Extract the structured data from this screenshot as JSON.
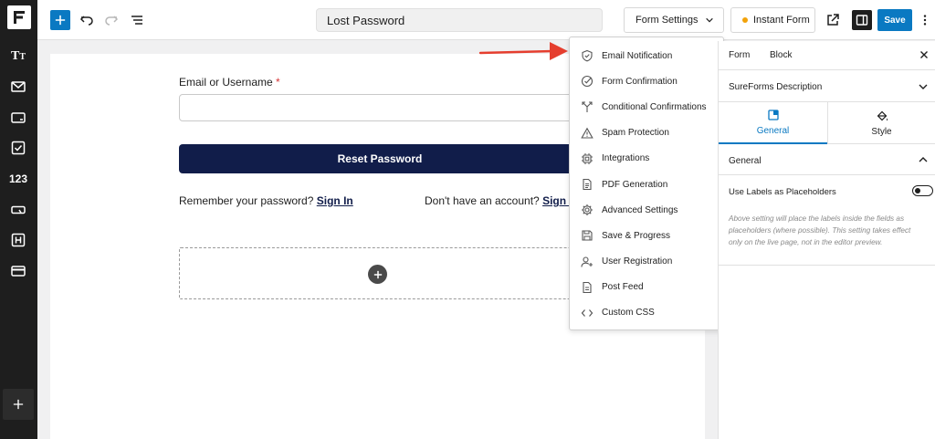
{
  "sidebar": {
    "logo": "sureforms-logo",
    "numbers_label": "123",
    "icons": [
      "typography-icon",
      "mail-icon",
      "input-icon",
      "checkbox-icon",
      "numbers-icon",
      "button-icon",
      "heading-icon",
      "card-icon"
    ],
    "add_icon": "plus-icon"
  },
  "toolbar": {
    "title": "Lost Password",
    "form_settings_label": "Form Settings",
    "instant_form_label": "Instant Form",
    "save_label": "Save"
  },
  "form": {
    "email_label": "Email or Username",
    "required_marker": "*",
    "email_value": "",
    "reset_button": "Reset Password",
    "remember_text": "Remember your password?",
    "sign_in_link": "Sign In",
    "dont_have_text": "Don't have an account?",
    "sign_up_link": "Sign U"
  },
  "dropdown": {
    "items": [
      {
        "label": "Email Notification",
        "icon": "shield-icon"
      },
      {
        "label": "Form Confirmation",
        "icon": "check-circle-icon"
      },
      {
        "label": "Conditional Confirmations",
        "icon": "split-arrow-icon"
      },
      {
        "label": "Spam Protection",
        "icon": "warning-icon"
      },
      {
        "label": "Integrations",
        "icon": "chip-icon"
      },
      {
        "label": "PDF Generation",
        "icon": "document-icon"
      },
      {
        "label": "Advanced Settings",
        "icon": "gear-icon"
      },
      {
        "label": "Save & Progress",
        "icon": "save-icon"
      },
      {
        "label": "User Registration",
        "icon": "user-plus-icon"
      },
      {
        "label": "Post Feed",
        "icon": "file-icon"
      },
      {
        "label": "Custom CSS",
        "icon": "code-icon"
      }
    ]
  },
  "right_panel": {
    "tab_form": "Form",
    "tab_block": "Block",
    "description_label": "SureForms Description",
    "subtab_general": "General",
    "subtab_style": "Style",
    "general_section": "General",
    "setting_label": "Use Labels as Placeholders",
    "setting_help": "Above setting will place the labels inside the fields as placeholders (where possible). This setting takes effect only on the live page, not in the editor preview."
  },
  "colors": {
    "accent": "#0a79c2",
    "button_dark": "#111d4a",
    "arrow": "#e53e2e",
    "sidebar_bg": "#1e1e1e"
  }
}
